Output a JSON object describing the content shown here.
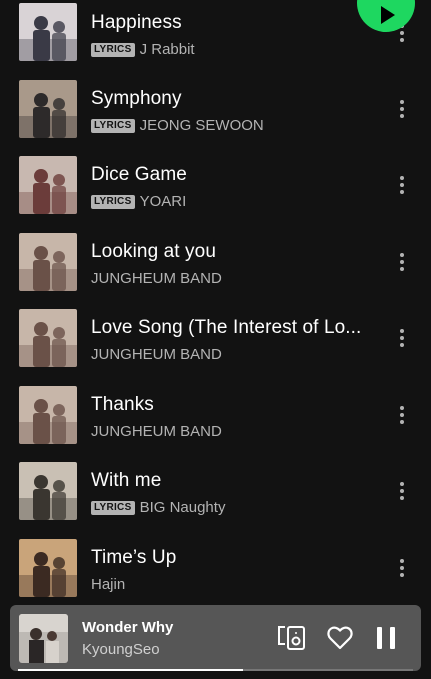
{
  "tracks": [
    {
      "title": "Happiness",
      "lyrics_badge": "LYRICS",
      "artist": "J Rabbit",
      "has_lyrics": true,
      "art_colors": [
        "#d9d3d6",
        "#3a3a46"
      ]
    },
    {
      "title": "Symphony",
      "lyrics_badge": "LYRICS",
      "artist": "JEONG SEWOON",
      "has_lyrics": true,
      "art_colors": [
        "#a9998a",
        "#2d2a2a"
      ]
    },
    {
      "title": "Dice Game",
      "lyrics_badge": "LYRICS",
      "artist": "YOARI",
      "has_lyrics": true,
      "art_colors": [
        "#c8b8b0",
        "#6b3c3a"
      ]
    },
    {
      "title": "Looking at you",
      "lyrics_badge": "",
      "artist": "JUNGHEUM BAND",
      "has_lyrics": false,
      "art_colors": [
        "#c7b6a9",
        "#6a5148"
      ]
    },
    {
      "title": "Love Song (The Interest of Lo...",
      "lyrics_badge": "",
      "artist": "JUNGHEUM BAND",
      "has_lyrics": false,
      "art_colors": [
        "#c7b6a9",
        "#6a5148"
      ]
    },
    {
      "title": "Thanks",
      "lyrics_badge": "",
      "artist": "JUNGHEUM BAND",
      "has_lyrics": false,
      "art_colors": [
        "#c7b6a9",
        "#6a5148"
      ]
    },
    {
      "title": "With me",
      "lyrics_badge": "LYRICS",
      "artist": "BIG Naughty",
      "has_lyrics": true,
      "art_colors": [
        "#c9c0b4",
        "#3a3630"
      ]
    },
    {
      "title": "Time’s Up",
      "lyrics_badge": "",
      "artist": "Hajin",
      "has_lyrics": false,
      "art_colors": [
        "#c9a47a",
        "#3b2a22"
      ]
    }
  ],
  "now_playing": {
    "title": "Wonder Why",
    "artist": "KyoungSeo",
    "progress": 0.57,
    "art_colors": [
      "#b9b6b2",
      "#2f2b2b"
    ]
  },
  "colors": {
    "background": "#121212",
    "accent_green": "#1ed760",
    "player_bg": "#565656",
    "secondary_text": "#b3b3b3"
  },
  "icons": {
    "play": "play-icon",
    "more": "more-vertical-icon",
    "devices": "connect-device-icon",
    "like": "heart-outline-icon",
    "pause": "pause-icon"
  }
}
